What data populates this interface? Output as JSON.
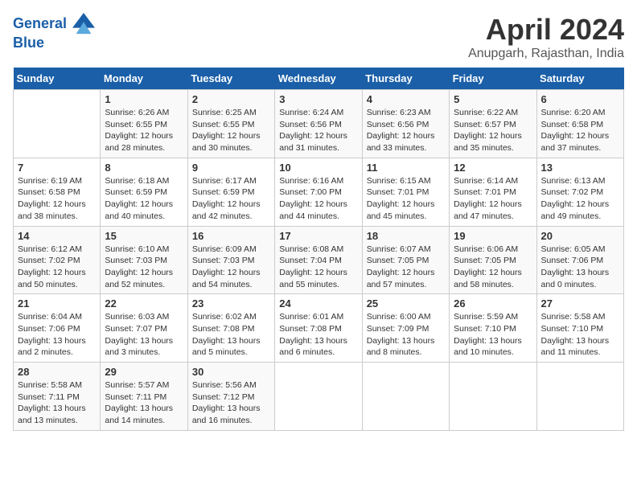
{
  "header": {
    "logo_line1": "General",
    "logo_line2": "Blue",
    "month": "April 2024",
    "location": "Anupgarh, Rajasthan, India"
  },
  "days_of_week": [
    "Sunday",
    "Monday",
    "Tuesday",
    "Wednesday",
    "Thursday",
    "Friday",
    "Saturday"
  ],
  "weeks": [
    [
      {
        "day": "",
        "info": ""
      },
      {
        "day": "1",
        "info": "Sunrise: 6:26 AM\nSunset: 6:55 PM\nDaylight: 12 hours\nand 28 minutes."
      },
      {
        "day": "2",
        "info": "Sunrise: 6:25 AM\nSunset: 6:55 PM\nDaylight: 12 hours\nand 30 minutes."
      },
      {
        "day": "3",
        "info": "Sunrise: 6:24 AM\nSunset: 6:56 PM\nDaylight: 12 hours\nand 31 minutes."
      },
      {
        "day": "4",
        "info": "Sunrise: 6:23 AM\nSunset: 6:56 PM\nDaylight: 12 hours\nand 33 minutes."
      },
      {
        "day": "5",
        "info": "Sunrise: 6:22 AM\nSunset: 6:57 PM\nDaylight: 12 hours\nand 35 minutes."
      },
      {
        "day": "6",
        "info": "Sunrise: 6:20 AM\nSunset: 6:58 PM\nDaylight: 12 hours\nand 37 minutes."
      }
    ],
    [
      {
        "day": "7",
        "info": "Sunrise: 6:19 AM\nSunset: 6:58 PM\nDaylight: 12 hours\nand 38 minutes."
      },
      {
        "day": "8",
        "info": "Sunrise: 6:18 AM\nSunset: 6:59 PM\nDaylight: 12 hours\nand 40 minutes."
      },
      {
        "day": "9",
        "info": "Sunrise: 6:17 AM\nSunset: 6:59 PM\nDaylight: 12 hours\nand 42 minutes."
      },
      {
        "day": "10",
        "info": "Sunrise: 6:16 AM\nSunset: 7:00 PM\nDaylight: 12 hours\nand 44 minutes."
      },
      {
        "day": "11",
        "info": "Sunrise: 6:15 AM\nSunset: 7:01 PM\nDaylight: 12 hours\nand 45 minutes."
      },
      {
        "day": "12",
        "info": "Sunrise: 6:14 AM\nSunset: 7:01 PM\nDaylight: 12 hours\nand 47 minutes."
      },
      {
        "day": "13",
        "info": "Sunrise: 6:13 AM\nSunset: 7:02 PM\nDaylight: 12 hours\nand 49 minutes."
      }
    ],
    [
      {
        "day": "14",
        "info": "Sunrise: 6:12 AM\nSunset: 7:02 PM\nDaylight: 12 hours\nand 50 minutes."
      },
      {
        "day": "15",
        "info": "Sunrise: 6:10 AM\nSunset: 7:03 PM\nDaylight: 12 hours\nand 52 minutes."
      },
      {
        "day": "16",
        "info": "Sunrise: 6:09 AM\nSunset: 7:03 PM\nDaylight: 12 hours\nand 54 minutes."
      },
      {
        "day": "17",
        "info": "Sunrise: 6:08 AM\nSunset: 7:04 PM\nDaylight: 12 hours\nand 55 minutes."
      },
      {
        "day": "18",
        "info": "Sunrise: 6:07 AM\nSunset: 7:05 PM\nDaylight: 12 hours\nand 57 minutes."
      },
      {
        "day": "19",
        "info": "Sunrise: 6:06 AM\nSunset: 7:05 PM\nDaylight: 12 hours\nand 58 minutes."
      },
      {
        "day": "20",
        "info": "Sunrise: 6:05 AM\nSunset: 7:06 PM\nDaylight: 13 hours\nand 0 minutes."
      }
    ],
    [
      {
        "day": "21",
        "info": "Sunrise: 6:04 AM\nSunset: 7:06 PM\nDaylight: 13 hours\nand 2 minutes."
      },
      {
        "day": "22",
        "info": "Sunrise: 6:03 AM\nSunset: 7:07 PM\nDaylight: 13 hours\nand 3 minutes."
      },
      {
        "day": "23",
        "info": "Sunrise: 6:02 AM\nSunset: 7:08 PM\nDaylight: 13 hours\nand 5 minutes."
      },
      {
        "day": "24",
        "info": "Sunrise: 6:01 AM\nSunset: 7:08 PM\nDaylight: 13 hours\nand 6 minutes."
      },
      {
        "day": "25",
        "info": "Sunrise: 6:00 AM\nSunset: 7:09 PM\nDaylight: 13 hours\nand 8 minutes."
      },
      {
        "day": "26",
        "info": "Sunrise: 5:59 AM\nSunset: 7:10 PM\nDaylight: 13 hours\nand 10 minutes."
      },
      {
        "day": "27",
        "info": "Sunrise: 5:58 AM\nSunset: 7:10 PM\nDaylight: 13 hours\nand 11 minutes."
      }
    ],
    [
      {
        "day": "28",
        "info": "Sunrise: 5:58 AM\nSunset: 7:11 PM\nDaylight: 13 hours\nand 13 minutes."
      },
      {
        "day": "29",
        "info": "Sunrise: 5:57 AM\nSunset: 7:11 PM\nDaylight: 13 hours\nand 14 minutes."
      },
      {
        "day": "30",
        "info": "Sunrise: 5:56 AM\nSunset: 7:12 PM\nDaylight: 13 hours\nand 16 minutes."
      },
      {
        "day": "",
        "info": ""
      },
      {
        "day": "",
        "info": ""
      },
      {
        "day": "",
        "info": ""
      },
      {
        "day": "",
        "info": ""
      }
    ]
  ]
}
